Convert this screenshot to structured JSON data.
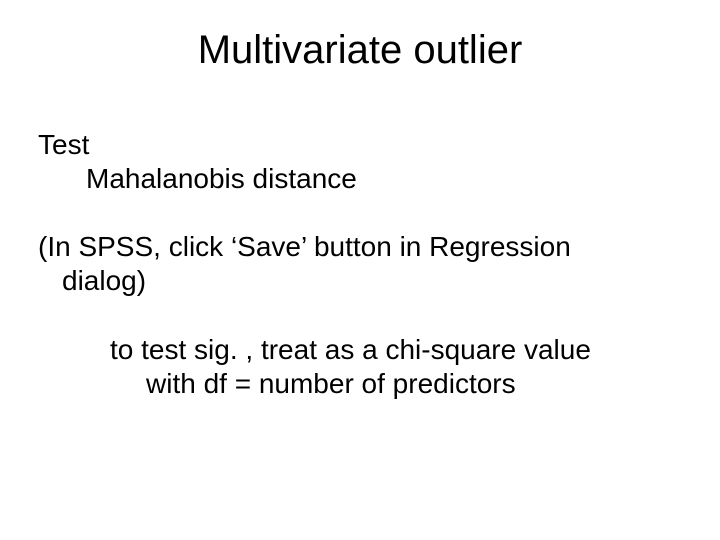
{
  "title": "Multivariate outlier",
  "body": {
    "test_label": "Test",
    "mahalanobis": "Mahalanobis distance",
    "spss_line1": "(In SPSS, click ‘Save’ button in Regression",
    "spss_line2": "dialog)",
    "sig_line1": "to test sig. , treat as a chi-square value",
    "sig_line2": "with df = number of predictors"
  }
}
